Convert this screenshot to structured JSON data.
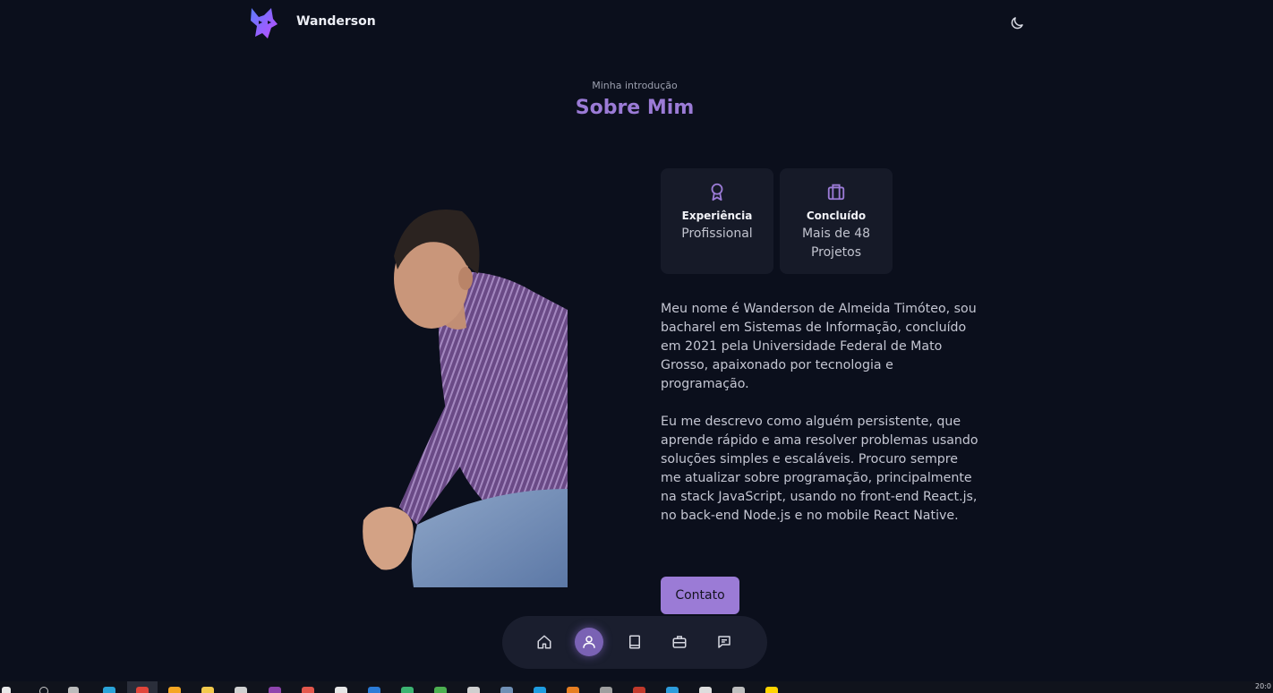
{
  "header": {
    "brand": "Wanderson"
  },
  "section": {
    "subtitle": "Minha introdução",
    "title": "Sobre Mim"
  },
  "cards": [
    {
      "icon": "award-icon",
      "title": "Experiência",
      "text": "Profissional"
    },
    {
      "icon": "briefcase-icon",
      "title": "Concluído",
      "text": "Mais de 48 Projetos"
    }
  ],
  "description": {
    "p1": "Meu nome é Wanderson de Almeida Timóteo, sou bacharel em Sistemas de Informação, concluído em 2021 pela Universidade Federal de Mato Grosso, apaixonado por tecnologia e programação.",
    "p2": "Eu me descrevo como alguém persistente, que aprende rápido e ama resolver problemas usando soluções simples e escaláveis. Procuro sempre me atualizar sobre programação, principalmente na stack JavaScript, usando no front-end React.js, no back-end Node.js e no mobile React Native."
  },
  "contact_button": "Contato",
  "nav": {
    "items": [
      {
        "icon": "home-icon",
        "active": false
      },
      {
        "icon": "user-icon",
        "active": true
      },
      {
        "icon": "book-icon",
        "active": false
      },
      {
        "icon": "briefcase-icon",
        "active": false
      },
      {
        "icon": "message-icon",
        "active": false
      }
    ]
  },
  "colors": {
    "background": "#0b0f1c",
    "accent": "#9b7bd6",
    "card": "#161a28"
  },
  "taskbar": {
    "clock": "20:0"
  }
}
